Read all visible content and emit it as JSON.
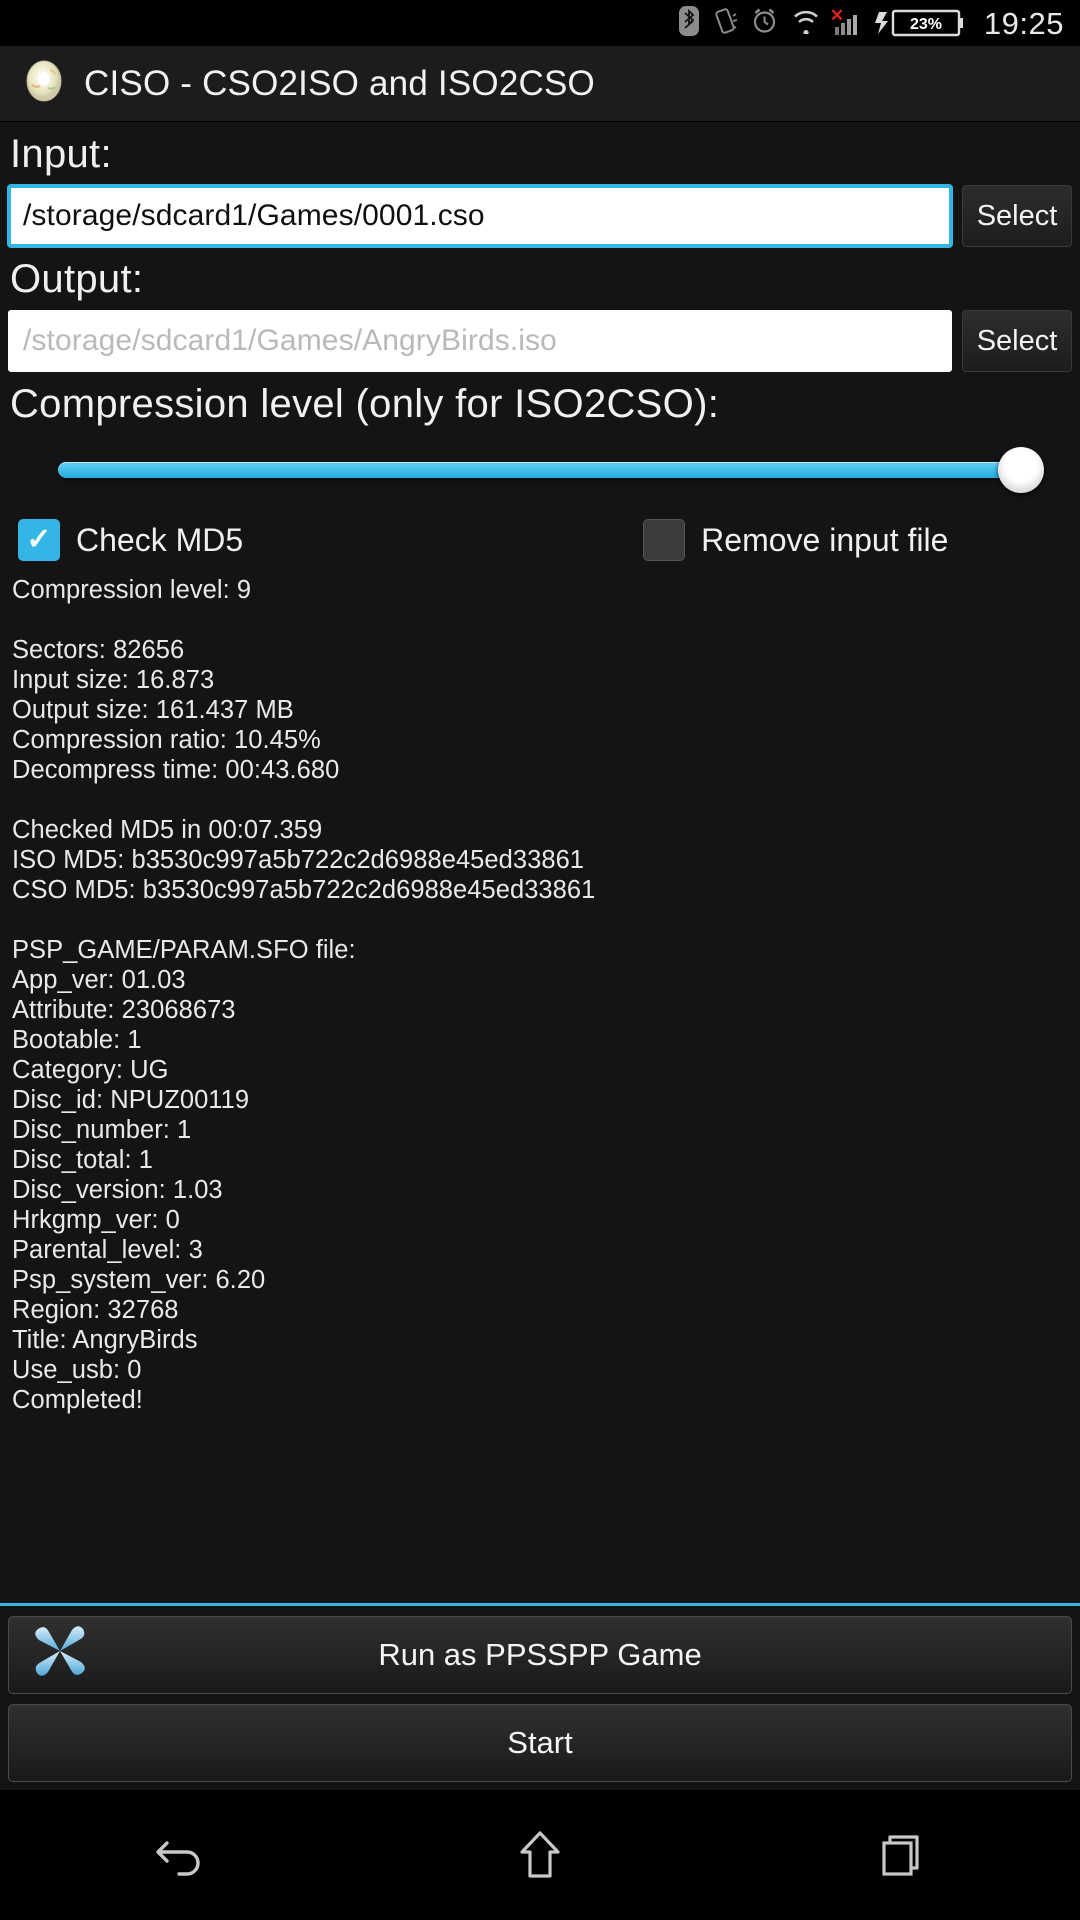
{
  "status_bar": {
    "icons": [
      "bluetooth-icon",
      "vibrate-icon",
      "alarm-icon",
      "wifi-icon",
      "signal-no-service-icon",
      "charging-icon"
    ],
    "battery_percent": "23%",
    "time": "19:25"
  },
  "app_bar": {
    "icon": "cd-disc-icon",
    "title": "CISO - CSO2ISO and ISO2CSO"
  },
  "input_section": {
    "label": "Input:",
    "value": "/storage/sdcard1/Games/0001.cso",
    "placeholder": "/storage/sdcard1/Games/0001.cso",
    "select_label": "Select"
  },
  "output_section": {
    "label": "Output:",
    "value": "",
    "placeholder": "/storage/sdcard1/Games/AngryBirds.iso",
    "select_label": "Select"
  },
  "compression": {
    "label": "Compression level (only for ISO2CSO):",
    "value": 9,
    "min": 0,
    "max": 9,
    "percent": 100
  },
  "options": {
    "check_md5": {
      "label": "Check MD5",
      "checked": true
    },
    "remove_input": {
      "label": "Remove input file",
      "checked": false
    }
  },
  "log": "Compression level: 9\n\nSectors: 82656\nInput size: 16.873\nOutput size: 161.437 MB\nCompression ratio: 10.45%\nDecompress time: 00:43.680\n\nChecked MD5 in 00:07.359\nISO MD5: b3530c997a5b722c2d6988e45ed33861\nCSO MD5: b3530c997a5b722c2d6988e45ed33861\n\nPSP_GAME/PARAM.SFO file:\nApp_ver: 01.03\nAttribute: 23068673\nBootable: 1\nCategory: UG\nDisc_id: NPUZ00119\nDisc_number: 1\nDisc_total: 1\nDisc_version: 1.03\nHrkgmp_ver: 0\nParental_level: 3\nPsp_system_ver: 6.20\nRegion: 32768\nTitle: AngryBirds\nUse_usb: 0\nCompleted!",
  "buttons": {
    "run_ppsspp": {
      "label": "Run as PPSSPP Game",
      "icon": "ppsspp-logo-icon"
    },
    "start": {
      "label": "Start"
    }
  },
  "nav_bar": {
    "back": "back-icon",
    "home": "home-icon",
    "recents": "recents-icon"
  },
  "colors": {
    "accent": "#33b5e5",
    "background": "#141414",
    "app_bar": "#1c1c1c",
    "text": "#f0f0f0"
  }
}
